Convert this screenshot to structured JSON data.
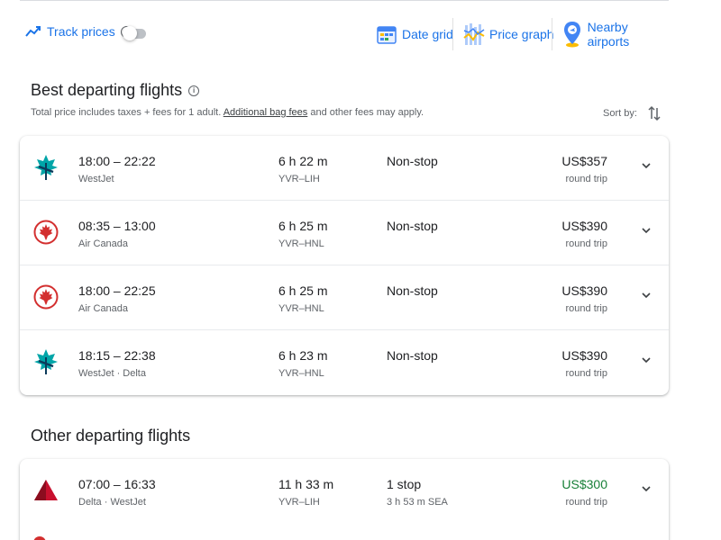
{
  "toolbar": {
    "track_prices_label": "Track prices",
    "track_prices_on": false,
    "date_grid_label": "Date grid",
    "price_graph_label": "Price graph",
    "nearby_airports_label": "Nearby airports"
  },
  "best": {
    "title": "Best departing flights",
    "note_prefix": "Total price includes taxes + fees for 1 adult. ",
    "note_link": "Additional bag fees",
    "note_suffix": " and other fees may apply.",
    "sort_label": "Sort by:",
    "flights": [
      {
        "logo": "westjet-logo-icon",
        "times": "18:00 – 22:22",
        "airline": "WestJet",
        "duration": "6 h 22 m",
        "route": "YVR–LIH",
        "stops": "Non-stop",
        "stop_info": "",
        "price": "US$357",
        "price_note": "round trip"
      },
      {
        "logo": "air-canada-logo-icon",
        "times": "08:35 – 13:00",
        "airline": "Air Canada",
        "duration": "6 h 25 m",
        "route": "YVR–HNL",
        "stops": "Non-stop",
        "stop_info": "",
        "price": "US$390",
        "price_note": "round trip"
      },
      {
        "logo": "air-canada-logo-icon",
        "times": "18:00 – 22:25",
        "airline": "Air Canada",
        "duration": "6 h 25 m",
        "route": "YVR–HNL",
        "stops": "Non-stop",
        "stop_info": "",
        "price": "US$390",
        "price_note": "round trip"
      },
      {
        "logo": "westjet-logo-icon",
        "times": "18:15 – 22:38",
        "airline": "WestJet · Delta",
        "duration": "6 h 23 m",
        "route": "YVR–HNL",
        "stops": "Non-stop",
        "stop_info": "",
        "price": "US$390",
        "price_note": "round trip"
      }
    ]
  },
  "other": {
    "title": "Other departing flights",
    "flights": [
      {
        "logo": "delta-logo-icon",
        "times": "07:00 – 16:33",
        "airline": "Delta · WestJet",
        "duration": "11 h 33 m",
        "route": "YVR–LIH",
        "stops": "1 stop",
        "stop_info": "3 h 53 m SEA",
        "price": "US$300",
        "price_note": "round trip",
        "price_highlight": true
      }
    ]
  },
  "colors": {
    "accent": "#1a73e8",
    "good_price": "#188038",
    "westjet_teal": "#00a5a8",
    "air_canada_red": "#d32f2f",
    "delta_red": "#c8102e"
  }
}
